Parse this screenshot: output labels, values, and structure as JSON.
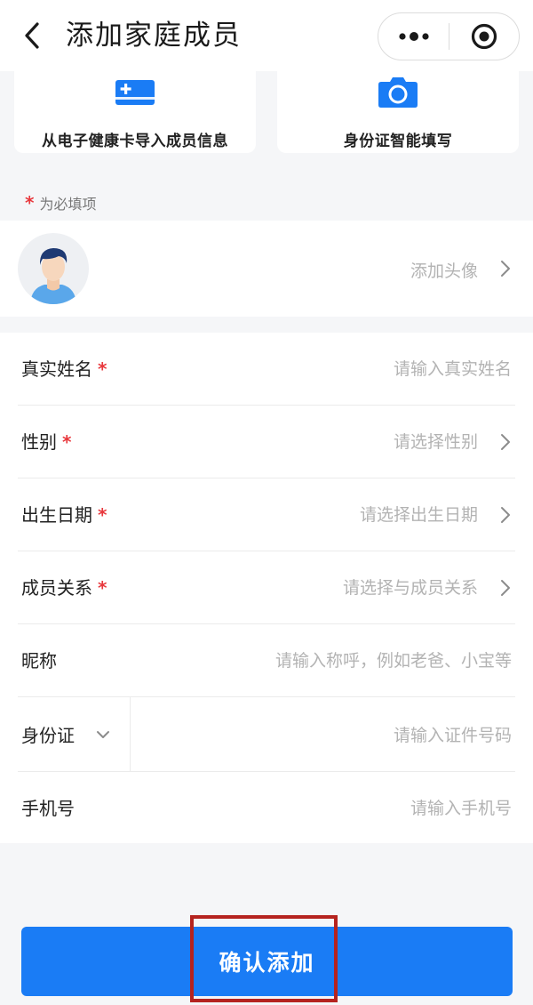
{
  "header": {
    "title": "添加家庭成员",
    "back_icon": "chevron-left-icon",
    "more_icon": "more-dots-icon",
    "target_icon": "target-icon"
  },
  "import_cards": [
    {
      "label": "从电子健康卡导入成员信息",
      "icon": "health-card-icon"
    },
    {
      "label": "身份证智能填写",
      "icon": "camera-icon"
    }
  ],
  "required_note": {
    "star": "*",
    "text": "为必填项"
  },
  "avatar_row": {
    "hint": "添加头像"
  },
  "form": {
    "rows": [
      {
        "label": "真实姓名",
        "required": "*",
        "placeholder": "请输入真实姓名"
      },
      {
        "label": "性别",
        "required": "*",
        "placeholder": "请选择性别"
      },
      {
        "label": "出生日期",
        "required": "*",
        "placeholder": "请选择出生日期"
      },
      {
        "label": "成员关系",
        "required": "*",
        "placeholder": "请选择与成员关系"
      },
      {
        "label": "昵称",
        "placeholder": "请输入称呼，例如老爸、小宝等"
      },
      {
        "label": "身份证",
        "placeholder": "请输入证件号码"
      },
      {
        "label": "手机号",
        "placeholder": "请输入手机号"
      }
    ]
  },
  "confirm_button": {
    "label": "确认添加"
  },
  "colors": {
    "accent": "#1a7cf5",
    "required": "#e8383d",
    "highlight": "#b5231f"
  }
}
